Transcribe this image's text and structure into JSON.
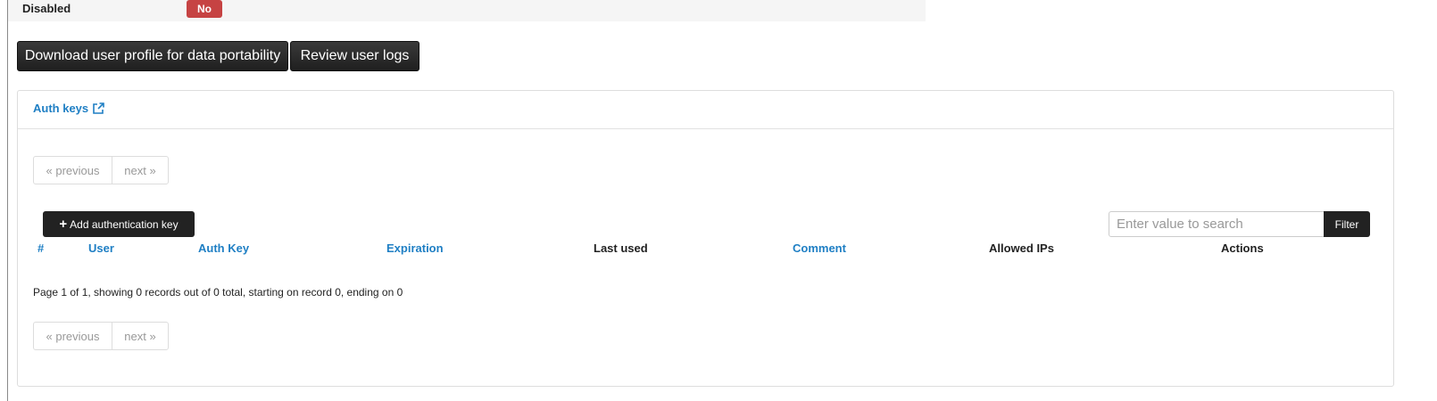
{
  "user_details": {
    "disabled_label": "Disabled",
    "disabled_value": "No",
    "disabled_badge_color": "#c64343"
  },
  "actions": {
    "download_label": "Download user profile for data portability",
    "logs_label": "Review user logs"
  },
  "auth_keys_panel": {
    "title": "Auth keys",
    "title_icon": "external-link-icon",
    "link_color": "#1f7fc4",
    "pager_top": {
      "previous": "« previous",
      "next": "next »"
    },
    "add_button": {
      "icon": "plus-icon",
      "label": "Add authentication key"
    },
    "search": {
      "placeholder": "Enter value to search",
      "value": "",
      "filter_label": "Filter"
    },
    "table": {
      "columns": [
        {
          "label": "#",
          "sortable": true
        },
        {
          "label": "User",
          "sortable": true
        },
        {
          "label": "Auth Key",
          "sortable": true
        },
        {
          "label": "Expiration",
          "sortable": true
        },
        {
          "label": "Last used",
          "sortable": false
        },
        {
          "label": "Comment",
          "sortable": true
        },
        {
          "label": "Allowed IPs",
          "sortable": false
        },
        {
          "label": "Actions",
          "sortable": false
        }
      ],
      "rows": []
    },
    "page_info": "Page 1 of 1, showing 0 records out of 0 total, starting on record 0, ending on 0",
    "pager_bottom": {
      "previous": "« previous",
      "next": "next »"
    }
  }
}
